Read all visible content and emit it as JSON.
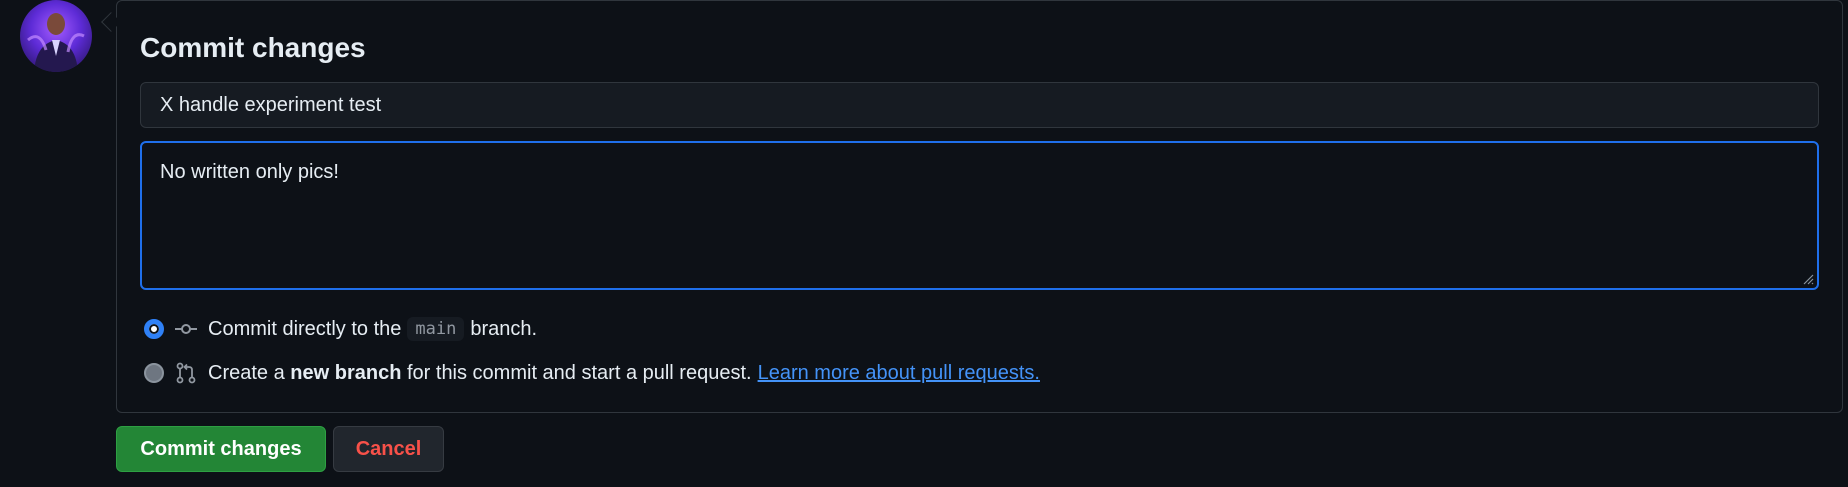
{
  "commit_panel": {
    "title": "Commit changes",
    "summary_value": "X handle experiment test",
    "description_value": "No written only pics!"
  },
  "options": {
    "direct": {
      "prefix": "Commit directly to the",
      "branch": "main",
      "suffix": "branch.",
      "selected": true,
      "icon": "git-commit-icon"
    },
    "new_branch": {
      "prefix": "Create a",
      "bold": "new branch",
      "suffix": "for this commit and start a pull request.",
      "link": "Learn more about pull requests.",
      "selected": false,
      "icon": "git-pull-request-icon"
    }
  },
  "actions": {
    "commit_label": "Commit changes",
    "cancel_label": "Cancel"
  },
  "colors": {
    "background": "#0d1117",
    "primary_button": "#238636",
    "focus_border": "#1f6feb",
    "link": "#4493f8",
    "cancel_text": "#f85149"
  }
}
